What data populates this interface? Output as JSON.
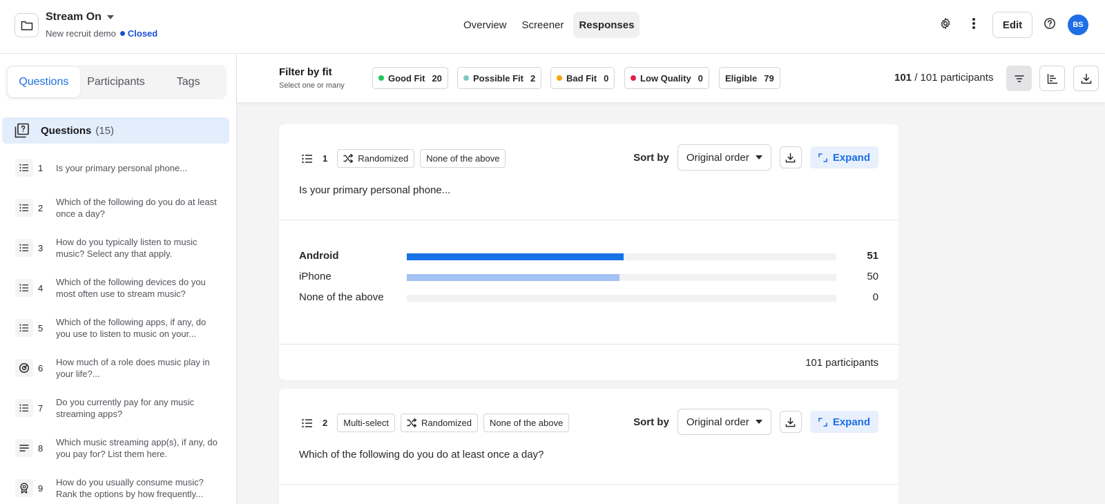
{
  "header": {
    "project_title": "Stream On",
    "project_subtitle": "New recruit demo",
    "status": "Closed",
    "nav": [
      "Overview",
      "Screener",
      "Responses"
    ],
    "active_nav": "Responses",
    "edit_label": "Edit",
    "avatar_initials": "BS",
    "accent": "#1e6fe6"
  },
  "sidebar": {
    "tabs": [
      "Questions",
      "Participants",
      "Tags"
    ],
    "active_tab": "Questions",
    "section_title": "Questions",
    "section_count": "(15)",
    "questions": [
      {
        "num": "1",
        "icon": "list-icon",
        "text": "Is your primary personal phone..."
      },
      {
        "num": "2",
        "icon": "list-icon",
        "text": "Which of the following do you do at least once a day?"
      },
      {
        "num": "3",
        "icon": "list-icon",
        "text": "How do you typically listen to music music? Select any that apply."
      },
      {
        "num": "4",
        "icon": "list-icon",
        "text": "Which of the following devices do you most often use to stream music?"
      },
      {
        "num": "5",
        "icon": "list-icon",
        "text": "Which of the following apps, if any, do you use to listen to music on your..."
      },
      {
        "num": "6",
        "icon": "gauge-icon",
        "text": "How much of a role does music play in your life?..."
      },
      {
        "num": "7",
        "icon": "list-icon",
        "text": "Do you currently pay for any music streaming apps?"
      },
      {
        "num": "8",
        "icon": "text-lines-icon",
        "text": "Which music streaming app(s), if any, do you pay for? List them here."
      },
      {
        "num": "9",
        "icon": "ranking-icon",
        "text": "How do you usually consume music? Rank the options by how frequently..."
      }
    ]
  },
  "filter": {
    "title": "Filter by fit",
    "subtitle": "Select one or many",
    "chips": [
      {
        "label": "Good Fit",
        "count": "20",
        "color": "#22c55e"
      },
      {
        "label": "Possible Fit",
        "count": "2",
        "color": "#7fc8c0"
      },
      {
        "label": "Bad Fit",
        "count": "0",
        "color": "#f5a60a"
      },
      {
        "label": "Low Quality",
        "count": "0",
        "color": "#e11d48"
      },
      {
        "label": "Eligible",
        "count": "79",
        "color": ""
      }
    ],
    "shown": "101",
    "total": "/ 101 participants"
  },
  "cards": [
    {
      "num": "1",
      "tags": [
        "Randomized",
        "None of the above"
      ],
      "sort_label": "Sort by",
      "sort_value": "Original order",
      "expand_label": "Expand",
      "question": "Is your primary personal phone...",
      "options": [
        {
          "label": "Android",
          "value": 51,
          "color": "#1672e6",
          "bold": true
        },
        {
          "label": "iPhone",
          "value": 50,
          "color": "#a3c1f2",
          "bold": false
        },
        {
          "label": "None of the above",
          "value": 0,
          "color": "#a3c1f2",
          "bold": false
        }
      ],
      "max": 101,
      "footer": "101 participants"
    },
    {
      "num": "2",
      "tags": [
        "Multi-select",
        "Randomized",
        "None of the above"
      ],
      "sort_label": "Sort by",
      "sort_value": "Original order",
      "expand_label": "Expand",
      "question": "Which of the following do you do at least once a day?"
    }
  ]
}
